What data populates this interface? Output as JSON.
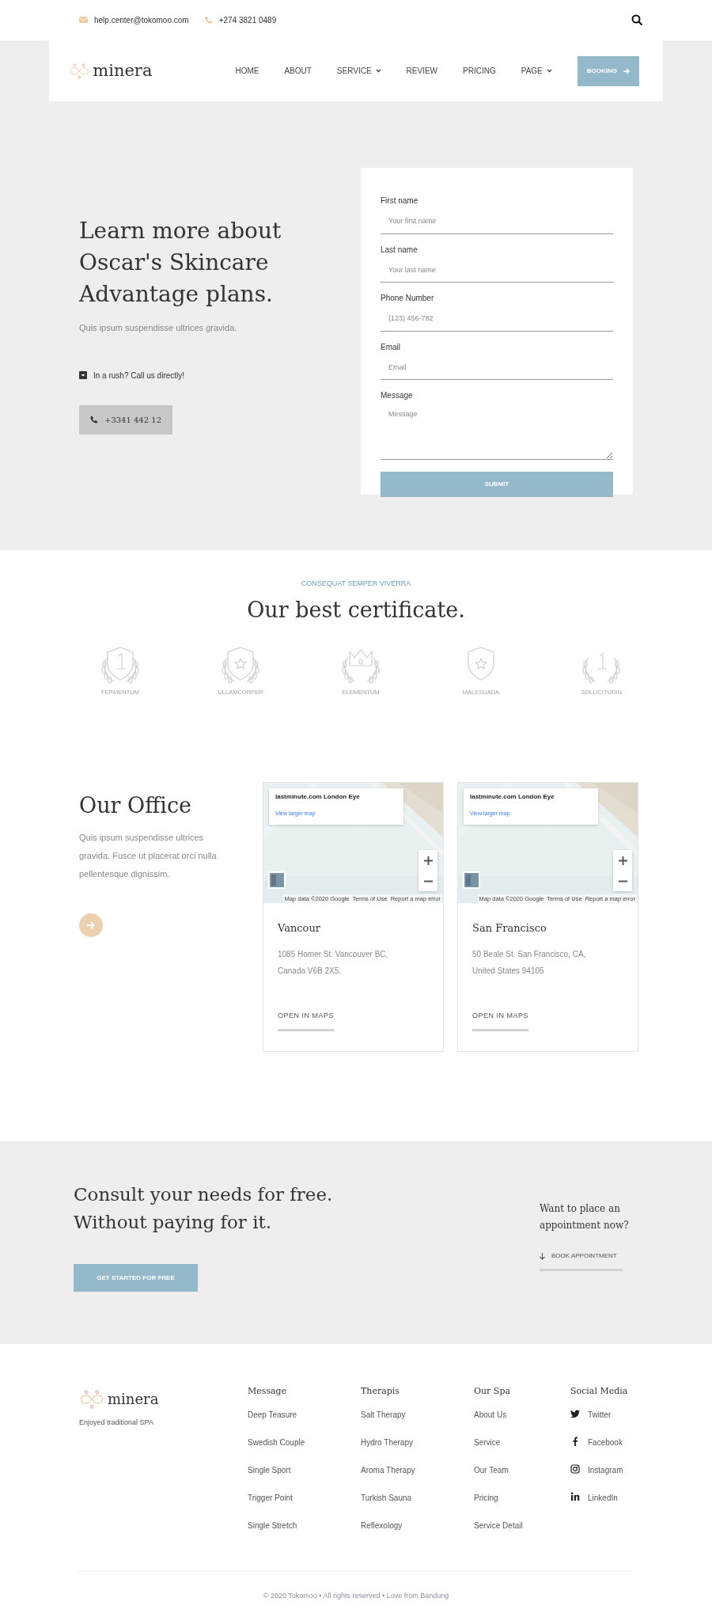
{
  "topbar": {
    "email": "help.center@tokomoo.com",
    "phone": "+274 3821 0489"
  },
  "nav": {
    "brand": "minera",
    "items": [
      {
        "label": "HOME",
        "dropdown": false
      },
      {
        "label": "ABOUT",
        "dropdown": false
      },
      {
        "label": "SERVICE",
        "dropdown": true
      },
      {
        "label": "REVIEW",
        "dropdown": false
      },
      {
        "label": "PRICING",
        "dropdown": false
      },
      {
        "label": "PAGE",
        "dropdown": true
      }
    ],
    "button": "BOOKING"
  },
  "hero": {
    "heading_lines": [
      "Learn more about",
      "Oscar's Skincare",
      "Advantage plans."
    ],
    "subtext": "Quis ipsum suspendisse ultrices gravida.",
    "rush_note": "In a rush? Call us directly!",
    "call_button": "+3341 442 12"
  },
  "form": {
    "fields": [
      {
        "kind": "input",
        "label": "First name",
        "placeholder": "Your first name"
      },
      {
        "kind": "input",
        "label": "Last name",
        "placeholder": "Your last name"
      },
      {
        "kind": "input",
        "label": "Phone Number",
        "placeholder": "(123) 456-782"
      },
      {
        "kind": "input",
        "label": "Email",
        "placeholder": "Email"
      },
      {
        "kind": "textarea",
        "label": "Message",
        "placeholder": "Message"
      }
    ],
    "submit": "SUBMIT"
  },
  "certificates": {
    "eyebrow": "CONSEQUAT SEMPER VIVERRA",
    "title": "Our best certificate.",
    "items": [
      {
        "label": "FERMENTUM",
        "kind": "shield-number"
      },
      {
        "label": "ULLAMCORPER",
        "kind": "shield-star"
      },
      {
        "label": "ELEMENTUM",
        "kind": "crown"
      },
      {
        "label": "MALESUADA",
        "kind": "badge-star"
      },
      {
        "label": "SOLLICITUDIN",
        "kind": "number"
      }
    ]
  },
  "office": {
    "title": "Our Office",
    "text": "Quis ipsum suspendisse ultrices gravida. Fusce ut placerat orci nulla pellentesque dignissim.",
    "locations": [
      {
        "map": {
          "place_title": "lastminute.com London Eye",
          "link": "View larger map",
          "attribution": [
            "Map data ©2020 Google",
            "Terms of Use",
            "Report a map error"
          ]
        },
        "name": "Vancour",
        "address_lines": [
          "1085 Homer St. Vancouver BC,",
          "Canada V6B 2X5."
        ],
        "link": "OPEN IN MAPS"
      },
      {
        "map": {
          "place_title": "lastminute.com London Eye",
          "link": "View larger map",
          "attribution": [
            "Map data ©2020 Google",
            "Terms of Use",
            "Report a map error"
          ]
        },
        "name": "San Francisco",
        "address_lines": [
          "50 Beale St. San Francisco, CA,",
          "United States 94105"
        ],
        "link": "OPEN IN MAPS"
      }
    ]
  },
  "cta": {
    "heading_lines": [
      "Consult your needs for free.",
      "Without paying for it."
    ],
    "button": "GET STARTED FOR FREE",
    "question_lines": [
      "Want to place an",
      "appointment now?"
    ],
    "book_link": "BOOK APPOINTMENT"
  },
  "footer": {
    "brand": "minera",
    "tagline": "Enjoyed traditional SPA",
    "columns": [
      {
        "title": "Message",
        "links": [
          "Deep Teasure",
          "Swedish Couple",
          "Single Sport",
          "Trigger Point",
          "Single Stretch"
        ]
      },
      {
        "title": "Therapis",
        "links": [
          "Salt Therapy",
          "Hydro Therapy",
          "Aroma Therapy",
          "Turkish Sauna",
          "Reflexology"
        ]
      },
      {
        "title": "Our Spa",
        "links": [
          "About Us",
          "Service",
          "Our Team",
          "Pricing",
          "Service Detail"
        ]
      }
    ],
    "social": {
      "title": "Social Media",
      "items": [
        {
          "kind": "twitter",
          "label": "Twitter"
        },
        {
          "kind": "facebook",
          "label": "Facebook"
        },
        {
          "kind": "instagram",
          "label": "Instagram"
        },
        {
          "kind": "linkedin",
          "label": "LinkedIn"
        }
      ]
    },
    "copyright": "© 2020 Tokomoo • All rights reserved • Love from Bandung"
  }
}
